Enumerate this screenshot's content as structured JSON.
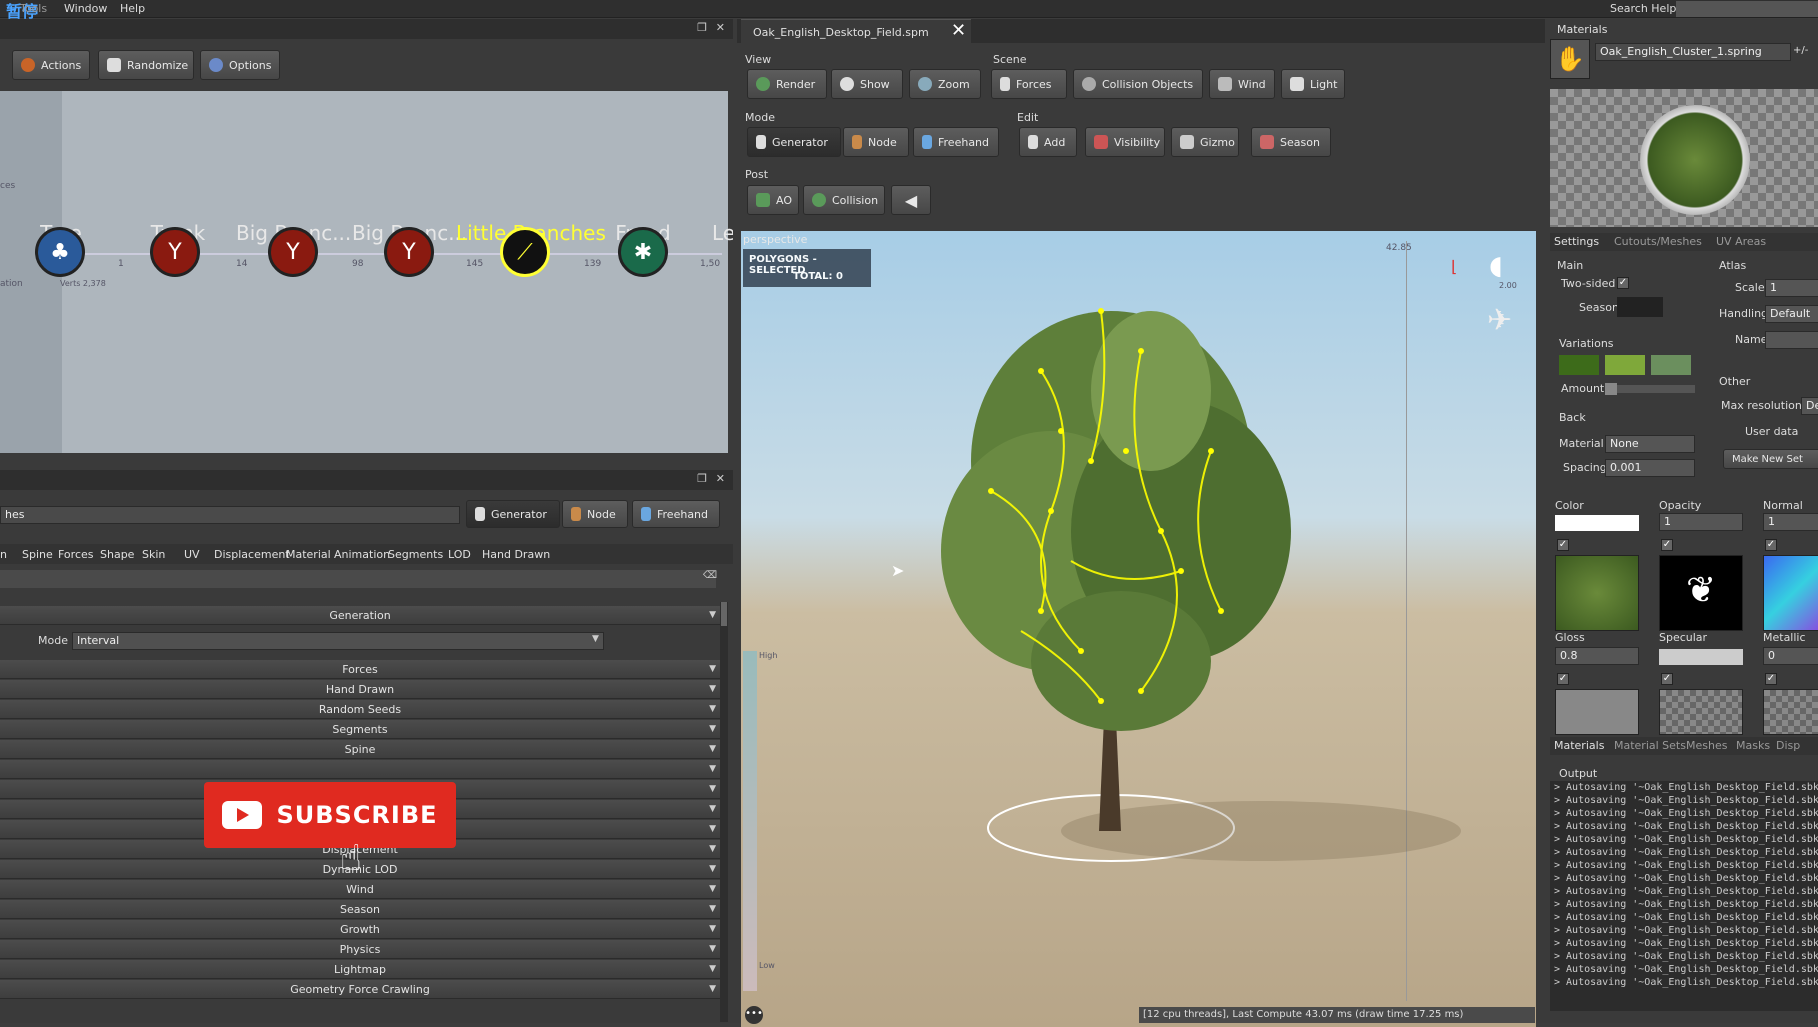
{
  "menubar": {
    "tools": "Tools",
    "window": "Window",
    "help": "Help",
    "search_help": "Search Help:",
    "overlay_text": "暂停"
  },
  "graph_toolbar": {
    "actions": "Actions",
    "randomize": "Randomize",
    "options": "Options"
  },
  "graph_nodes": [
    {
      "label": "Tree",
      "sub": ""
    },
    {
      "label": "Trunk",
      "sub": "1"
    },
    {
      "label": "Big Branc...",
      "sub": "14"
    },
    {
      "label": "Big Branc...",
      "sub": "98"
    },
    {
      "label": "Little Branches",
      "sub": "145"
    },
    {
      "label": "Frond",
      "sub": "139"
    },
    {
      "label": "Le",
      "sub": "1,50"
    }
  ],
  "graph_misc": {
    "left_label_1": "ces",
    "left_label_2": "ation",
    "tree_sub": "Verts 2,378"
  },
  "props_panel": {
    "search_text": "hes",
    "mode_buttons": [
      "Generator",
      "Node",
      "Freehand"
    ],
    "tabs": [
      "n",
      "Spine",
      "Forces",
      "Shape",
      "Skin",
      "UV",
      "Displacement",
      "Material",
      "Animation",
      "Segments",
      "LOD",
      "Hand Drawn"
    ],
    "section_title": "Generation",
    "mode_label": "Mode",
    "mode_value": "Interval",
    "rows": [
      "Forces",
      "Hand Drawn",
      "Random Seeds",
      "Segments",
      "Spine",
      "",
      "",
      "",
      "",
      "Displacement",
      "Dynamic LOD",
      "Wind",
      "Season",
      "Growth",
      "Physics",
      "Lightmap",
      "Geometry Force Crawling"
    ]
  },
  "subscribe": {
    "label": "SUBSCRIBE"
  },
  "viewport_tab": {
    "title": "Oak_English_Desktop_Field.spm",
    "close": "✕"
  },
  "viewport_toolbar": {
    "view_label": "View",
    "scene_label": "Scene",
    "mode_label": "Mode",
    "edit_label": "Edit",
    "post_label": "Post",
    "view": [
      "Render",
      "Show",
      "Zoom"
    ],
    "scene": [
      "Forces",
      "Collision Objects",
      "Wind",
      "Light"
    ],
    "mode": [
      "Generator",
      "Node",
      "Freehand"
    ],
    "edit": [
      "Add",
      "Visibility",
      "Gizmo",
      "Season"
    ],
    "post": [
      "AO",
      "Collision"
    ]
  },
  "viewport": {
    "perspective": "perspective",
    "selected": "POLYGONS - SELECTED",
    "total": "TOTAL: 0",
    "top_num": "42.85",
    "gizmo_num": "2.00",
    "status": "[12 cpu threads], Last Compute 43.07 ms (draw time 17.25 ms)",
    "high": "High",
    "low": "Low"
  },
  "materials_panel": {
    "title": "Materials",
    "selected": "Oak_English_Cluster_1.spring",
    "plusminus": "+/-",
    "tabs": [
      "Settings",
      "Cutouts/Meshes",
      "UV Areas"
    ],
    "main_label": "Main",
    "atlas_label": "Atlas",
    "two_sided": "Two-sided",
    "season": "Season",
    "scale": "Scale",
    "scale_value": "1",
    "handling": "Handling",
    "handling_value": "Default",
    "name": "Name",
    "variations": "Variations",
    "amount": "Amount",
    "other": "Other",
    "max_res": "Max resolution",
    "max_res_value": "Def",
    "user_data": "User data",
    "back": "Back",
    "material": "Material",
    "material_value": "None",
    "spacing": "Spacing",
    "spacing_value": "0.001",
    "make_new": "Make New Set",
    "color": "Color",
    "opacity": "Opacity",
    "opacity_value": "1",
    "normal": "Normal",
    "normal_value": "1",
    "gloss": "Gloss",
    "gloss_value": "0.8",
    "specular": "Specular",
    "metallic": "Metallic",
    "metallic_value": "0",
    "bottom_tabs": [
      "Materials",
      "Material Sets",
      "Meshes",
      "Masks",
      "Disp"
    ],
    "variation_colors": [
      "#3d6b1a",
      "#7fa83a",
      "#6b8f5e"
    ]
  },
  "output": {
    "title": "Output",
    "lines": [
      "> Autosaving '~Oak_English_Desktop_Field.sbk' ... faile",
      "> Autosaving '~Oak_English_Desktop_Field.sbk' ... faile",
      "> Autosaving '~Oak_English_Desktop_Field.sbk' ... faile",
      "> Autosaving '~Oak_English_Desktop_Field.sbk' ... faile",
      "> Autosaving '~Oak_English_Desktop_Field.sbk' ... faile",
      "> Autosaving '~Oak_English_Desktop_Field.sbk' ... faile",
      "> Autosaving '~Oak_English_Desktop_Field.sbk' ... faile",
      "> Autosaving '~Oak_English_Desktop_Field.sbk' ... faile",
      "> Autosaving '~Oak_English_Desktop_Field.sbk' ... faile",
      "> Autosaving '~Oak_English_Desktop_Field.sbk' ... faile",
      "> Autosaving '~Oak_English_Desktop_Field.sbk' ... faile",
      "> Autosaving '~Oak_English_Desktop_Field.sbk' ... faile",
      "> Autosaving '~Oak_English_Desktop_Field.sbk' ... faile",
      "> Autosaving '~Oak_English_Desktop_Field.sbk' ... faile",
      "> Autosaving '~Oak_English_Desktop_Field.sbk' ... faile",
      "> Autosaving '~Oak_English_Desktop_Field.sbk' ... faile"
    ]
  }
}
